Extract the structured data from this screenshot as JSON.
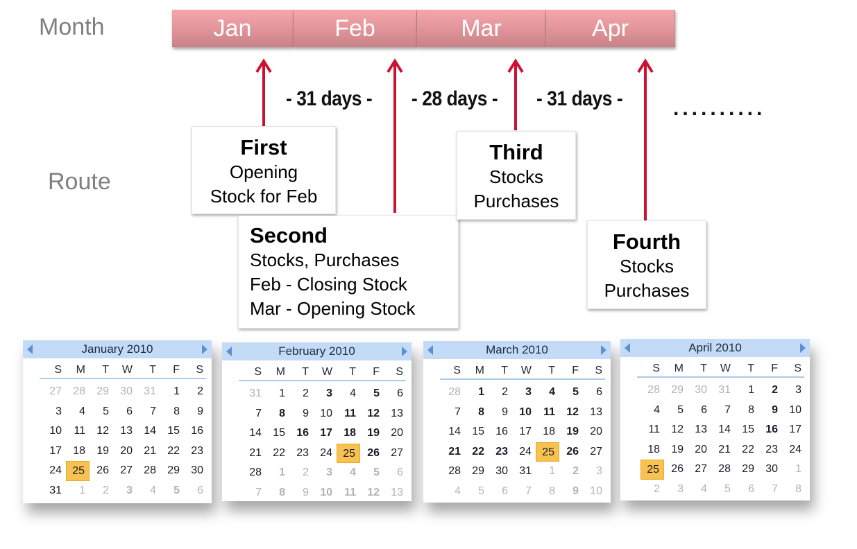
{
  "labels": {
    "month": "Month",
    "route": "Route"
  },
  "months": [
    {
      "label": "Jan"
    },
    {
      "label": "Feb"
    },
    {
      "label": "Mar"
    },
    {
      "label": "Apr"
    }
  ],
  "gaps": [
    {
      "label": "- 31 days -"
    },
    {
      "label": "- 28 days -"
    },
    {
      "label": "- 31 days -"
    }
  ],
  "continuation": "..........",
  "routes": [
    {
      "title": "First",
      "lines": [
        "Opening",
        "Stock for Feb"
      ]
    },
    {
      "title": "Second",
      "lines": [
        "Stocks, Purchases",
        "Feb - Closing Stock",
        "Mar - Opening  Stock"
      ]
    },
    {
      "title": "Third",
      "lines": [
        "Stocks",
        "Purchases"
      ]
    },
    {
      "title": "Fourth",
      "lines": [
        "Stocks",
        "Purchases"
      ]
    }
  ],
  "colors": {
    "arrow": "#cc1133",
    "month_bar": "#e4979c",
    "calendar_header": "#c3dbf7",
    "today_highlight": "#f7c24f"
  },
  "calendars": [
    {
      "title": "January 2010",
      "weekdays": [
        "S",
        "M",
        "T",
        "W",
        "T",
        "F",
        "S"
      ],
      "selected_day": 25,
      "days": [
        {
          "d": "27",
          "other": true
        },
        {
          "d": "28",
          "other": true
        },
        {
          "d": "29",
          "other": true
        },
        {
          "d": "30",
          "other": true
        },
        {
          "d": "31",
          "other": true
        },
        {
          "d": "1"
        },
        {
          "d": "2"
        },
        {
          "d": "3"
        },
        {
          "d": "4"
        },
        {
          "d": "5"
        },
        {
          "d": "6"
        },
        {
          "d": "7"
        },
        {
          "d": "8"
        },
        {
          "d": "9"
        },
        {
          "d": "10"
        },
        {
          "d": "11"
        },
        {
          "d": "12"
        },
        {
          "d": "13"
        },
        {
          "d": "14"
        },
        {
          "d": "15"
        },
        {
          "d": "16"
        },
        {
          "d": "17"
        },
        {
          "d": "18"
        },
        {
          "d": "19"
        },
        {
          "d": "20"
        },
        {
          "d": "21"
        },
        {
          "d": "22"
        },
        {
          "d": "23"
        },
        {
          "d": "24"
        },
        {
          "d": "25",
          "today": true
        },
        {
          "d": "26"
        },
        {
          "d": "27"
        },
        {
          "d": "28"
        },
        {
          "d": "29"
        },
        {
          "d": "30"
        },
        {
          "d": "31"
        },
        {
          "d": "1",
          "other": true
        },
        {
          "d": "2",
          "other": true
        },
        {
          "d": "3",
          "other": true,
          "bold": true
        },
        {
          "d": "4",
          "other": true
        },
        {
          "d": "5",
          "other": true,
          "bold": true
        },
        {
          "d": "6",
          "other": true
        }
      ]
    },
    {
      "title": "February 2010",
      "weekdays": [
        "S",
        "M",
        "T",
        "W",
        "T",
        "F",
        "S"
      ],
      "selected_day": 25,
      "days": [
        {
          "d": "31",
          "other": true
        },
        {
          "d": "1"
        },
        {
          "d": "2"
        },
        {
          "d": "3",
          "bold": true
        },
        {
          "d": "4"
        },
        {
          "d": "5",
          "bold": true
        },
        {
          "d": "6"
        },
        {
          "d": "7"
        },
        {
          "d": "8",
          "bold": true
        },
        {
          "d": "9"
        },
        {
          "d": "10"
        },
        {
          "d": "11",
          "bold": true
        },
        {
          "d": "12",
          "bold": true
        },
        {
          "d": "13"
        },
        {
          "d": "14"
        },
        {
          "d": "15"
        },
        {
          "d": "16",
          "bold": true
        },
        {
          "d": "17",
          "bold": true
        },
        {
          "d": "18",
          "bold": true
        },
        {
          "d": "19",
          "bold": true
        },
        {
          "d": "20"
        },
        {
          "d": "21"
        },
        {
          "d": "22"
        },
        {
          "d": "23"
        },
        {
          "d": "24"
        },
        {
          "d": "25",
          "today": true
        },
        {
          "d": "26",
          "bold": true
        },
        {
          "d": "27"
        },
        {
          "d": "28"
        },
        {
          "d": "1",
          "other": true,
          "bold": true
        },
        {
          "d": "2",
          "other": true
        },
        {
          "d": "3",
          "other": true,
          "bold": true
        },
        {
          "d": "4",
          "other": true,
          "bold": true
        },
        {
          "d": "5",
          "other": true,
          "bold": true
        },
        {
          "d": "6",
          "other": true
        },
        {
          "d": "7",
          "other": true
        },
        {
          "d": "8",
          "other": true,
          "bold": true
        },
        {
          "d": "9",
          "other": true
        },
        {
          "d": "10",
          "other": true,
          "bold": true
        },
        {
          "d": "11",
          "other": true,
          "bold": true
        },
        {
          "d": "12",
          "other": true,
          "bold": true
        },
        {
          "d": "13",
          "other": true
        }
      ]
    },
    {
      "title": "March 2010",
      "weekdays": [
        "S",
        "M",
        "T",
        "W",
        "T",
        "F",
        "S"
      ],
      "selected_day": 25,
      "days": [
        {
          "d": "28",
          "other": true
        },
        {
          "d": "1",
          "bold": true
        },
        {
          "d": "2"
        },
        {
          "d": "3",
          "bold": true
        },
        {
          "d": "4",
          "bold": true
        },
        {
          "d": "5",
          "bold": true
        },
        {
          "d": "6"
        },
        {
          "d": "7"
        },
        {
          "d": "8",
          "bold": true
        },
        {
          "d": "9"
        },
        {
          "d": "10",
          "bold": true
        },
        {
          "d": "11",
          "bold": true
        },
        {
          "d": "12",
          "bold": true
        },
        {
          "d": "13"
        },
        {
          "d": "14"
        },
        {
          "d": "15"
        },
        {
          "d": "16"
        },
        {
          "d": "17"
        },
        {
          "d": "18"
        },
        {
          "d": "19",
          "bold": true
        },
        {
          "d": "20"
        },
        {
          "d": "21",
          "bold": true
        },
        {
          "d": "22",
          "bold": true
        },
        {
          "d": "23",
          "bold": true
        },
        {
          "d": "24"
        },
        {
          "d": "25",
          "today": true
        },
        {
          "d": "26",
          "bold": true
        },
        {
          "d": "27"
        },
        {
          "d": "28"
        },
        {
          "d": "29"
        },
        {
          "d": "30"
        },
        {
          "d": "31"
        },
        {
          "d": "1",
          "other": true
        },
        {
          "d": "2",
          "other": true,
          "bold": true
        },
        {
          "d": "3",
          "other": true
        },
        {
          "d": "4",
          "other": true
        },
        {
          "d": "5",
          "other": true
        },
        {
          "d": "6",
          "other": true
        },
        {
          "d": "7",
          "other": true
        },
        {
          "d": "8",
          "other": true
        },
        {
          "d": "9",
          "other": true,
          "bold": true
        },
        {
          "d": "10",
          "other": true
        }
      ]
    },
    {
      "title": "April 2010",
      "weekdays": [
        "S",
        "M",
        "T",
        "W",
        "T",
        "F",
        "S"
      ],
      "selected_day": 25,
      "days": [
        {
          "d": "28",
          "other": true
        },
        {
          "d": "29",
          "other": true
        },
        {
          "d": "30",
          "other": true
        },
        {
          "d": "31",
          "other": true
        },
        {
          "d": "1"
        },
        {
          "d": "2",
          "bold": true
        },
        {
          "d": "3"
        },
        {
          "d": "4"
        },
        {
          "d": "5"
        },
        {
          "d": "6"
        },
        {
          "d": "7"
        },
        {
          "d": "8"
        },
        {
          "d": "9",
          "bold": true
        },
        {
          "d": "10"
        },
        {
          "d": "11"
        },
        {
          "d": "12"
        },
        {
          "d": "13"
        },
        {
          "d": "14"
        },
        {
          "d": "15"
        },
        {
          "d": "16",
          "bold": true
        },
        {
          "d": "17"
        },
        {
          "d": "18"
        },
        {
          "d": "19"
        },
        {
          "d": "20"
        },
        {
          "d": "21"
        },
        {
          "d": "22"
        },
        {
          "d": "23"
        },
        {
          "d": "24"
        },
        {
          "d": "25",
          "today": true
        },
        {
          "d": "26"
        },
        {
          "d": "27"
        },
        {
          "d": "28"
        },
        {
          "d": "29"
        },
        {
          "d": "30"
        },
        {
          "d": "1",
          "other": true
        },
        {
          "d": "2",
          "other": true
        },
        {
          "d": "3",
          "other": true
        },
        {
          "d": "4",
          "other": true
        },
        {
          "d": "5",
          "other": true
        },
        {
          "d": "6",
          "other": true
        },
        {
          "d": "7",
          "other": true
        },
        {
          "d": "8",
          "other": true
        }
      ]
    }
  ]
}
